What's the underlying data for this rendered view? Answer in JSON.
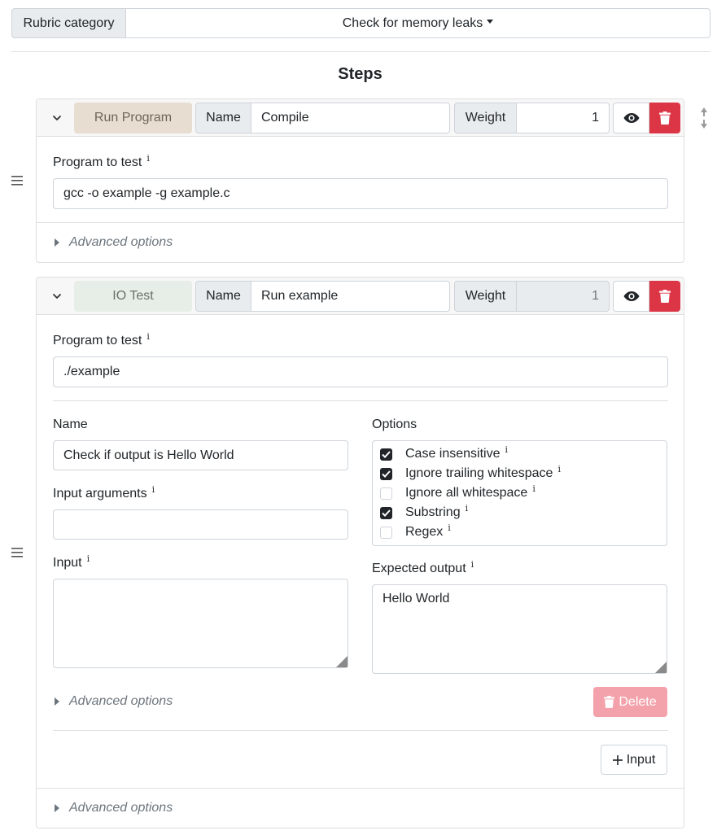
{
  "rubric": {
    "label": "Rubric category",
    "selected": "Check for memory leaks"
  },
  "steps_title": "Steps",
  "colors": {
    "run_program_badge": "#e7ddd0",
    "io_test_badge": "#e7ede7",
    "danger": "#dc3545",
    "danger_disabled": "#f3a2ab"
  },
  "steps": [
    {
      "type_label": "Run Program",
      "name_label": "Name",
      "name_value": "Compile",
      "weight_label": "Weight",
      "weight_value": "1",
      "program_label": "Program to test",
      "program_value": "gcc -o example -g example.c",
      "advanced_label": "Advanced options"
    },
    {
      "type_label": "IO Test",
      "name_label": "Name",
      "name_value": "Run example",
      "weight_label": "Weight",
      "weight_value": "1",
      "program_label": "Program to test",
      "program_value": "./example",
      "test": {
        "name_label": "Name",
        "name_value": "Check if output is Hello World",
        "args_label": "Input arguments",
        "args_value": "",
        "input_label": "Input",
        "input_value": "",
        "options_label": "Options",
        "options": [
          {
            "label": "Case insensitive",
            "checked": true
          },
          {
            "label": "Ignore trailing whitespace",
            "checked": true
          },
          {
            "label": "Ignore all whitespace",
            "checked": false
          },
          {
            "label": "Substring",
            "checked": true
          },
          {
            "label": "Regex",
            "checked": false
          }
        ],
        "expected_label": "Expected output",
        "expected_value": "Hello World",
        "advanced_label": "Advanced options",
        "delete_label": "Delete"
      },
      "add_input_label": "Input",
      "advanced_label": "Advanced options"
    }
  ]
}
